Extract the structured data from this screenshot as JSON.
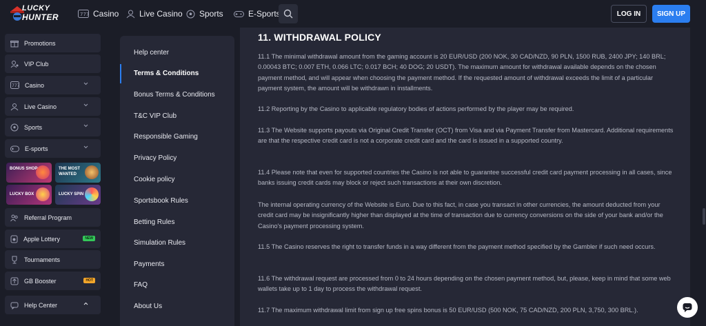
{
  "header": {
    "logo_line1": "LUCKY",
    "logo_line2": "HUNTER",
    "nav": [
      {
        "label": "Casino",
        "icon": "slot-machine-icon"
      },
      {
        "label": "Live Casino",
        "icon": "dealer-icon"
      },
      {
        "label": "Sports",
        "icon": "soccer-ball-icon"
      },
      {
        "label": "E-Sports",
        "icon": "gamepad-icon"
      }
    ],
    "login": "LOG IN",
    "signup": "SIGN UP"
  },
  "sidebar": {
    "items": [
      {
        "label": "Promotions",
        "icon": "gift-icon"
      },
      {
        "label": "VIP Club",
        "icon": "vip-user-icon"
      },
      {
        "label": "Casino",
        "icon": "slot-machine-icon"
      },
      {
        "label": "Live Casino",
        "icon": "dealer-icon"
      },
      {
        "label": "Sports",
        "icon": "soccer-ball-icon"
      },
      {
        "label": "E-sports",
        "icon": "gamepad-icon"
      }
    ],
    "promos": [
      {
        "label": "BONUS SHOP"
      },
      {
        "label": "THE MOST WANTED"
      },
      {
        "label": "LUCKY BOX"
      },
      {
        "label": "LUCKY SPIN"
      }
    ],
    "bottom_items": [
      {
        "label": "Referral Program",
        "icon": "referral-icon"
      },
      {
        "label": "Apple Lottery",
        "icon": "apple-icon",
        "badge": "NEW"
      },
      {
        "label": "Tournaments",
        "icon": "trophy-icon"
      },
      {
        "label": "GB Booster",
        "icon": "booster-icon",
        "badge": "HOT"
      },
      {
        "label": "Help Center",
        "icon": "help-icon"
      }
    ]
  },
  "menu": {
    "items": [
      "Help center",
      "Terms & Conditions",
      "Bonus Terms & Conditions",
      "T&C VIP Club",
      "Responsible Gaming",
      "Privacy Policy",
      "Cookie policy",
      "Sportsbook Rules",
      "Betting Rules",
      "Simulation Rules",
      "Payments",
      "FAQ",
      "About Us"
    ],
    "active_index": 1
  },
  "content": {
    "title": "11. WITHDRAWAL POLICY",
    "paragraphs": [
      "11.1 The minimal withdrawal amount from the gaming account is 20 EUR/USD (200 NOK, 30 CAD/NZD, 90 PLN, 1500 RUB, 2400 JPY; 140 BRL; 0.00043 BTC; 0.007 ETH, 0.066 LTC; 0.017 BCH; 40 DOG; 20 USDT). The maximum amount for withdrawal available depends on the chosen payment method, and will appear when choosing the payment method. If the requested amount of withdrawal exceeds the limit of a particular payment system, the amount will be withdrawn in installments.",
      "11.2 Reporting by the Casino to applicable regulatory bodies of actions performed by the player may be required.",
      "11.3 The Website supports payouts via Original Credit Transfer (OCT) from Visa and via Payment Transfer from Mastercard. Additional requirements are that the respective credit card is not a corporate credit card and the card is issued in a supported country.",
      "11.4 Please note that even for supported countries the Casino is not able to guarantee successful credit card payment processing in all cases, since banks issuing credit cards may block or reject such transactions at their own discretion.",
      "The internal operating currency of the Website is Euro. Due to this fact, in case you transact in other currencies, the amount deducted from your credit card may be insignificantly higher than displayed at the time of transaction due to currency conversions on the side of your bank and/or the Casino's payment processing system.",
      "11.5 The Casino reserves the right to transfer funds in a way different from the payment method specified by the Gambler if such need occurs.",
      "11.6 The withdrawal request are processed from 0 to 24 hours depending on the chosen payment method, but, please, keep in mind that some web wallets take up to 1 day to process the withdrawal request.",
      "11.7 The maximum withdrawal limit from sign up free spins bonus is 50 EUR/USD (500 NOK, 75 CAD/NZD, 200 PLN, 3,750, 300 BRL.)."
    ]
  },
  "colors": {
    "accent": "#2b7ef0",
    "background": "#1b1d27",
    "panel": "#262836"
  }
}
